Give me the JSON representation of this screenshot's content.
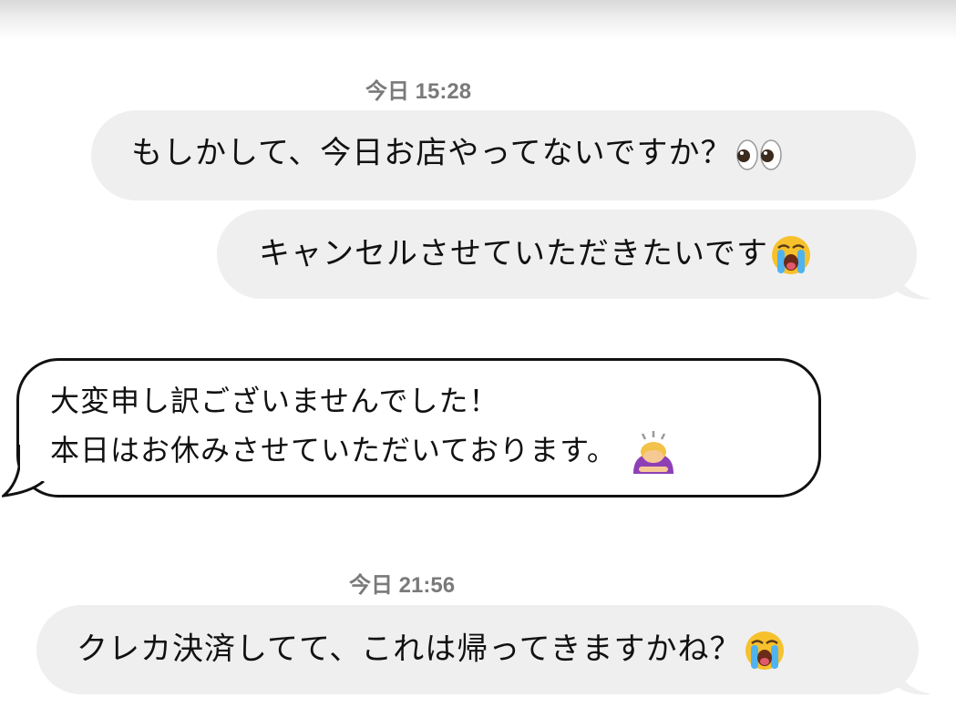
{
  "messages": [
    {
      "timestamp": "今日 15:28"
    },
    {
      "text": "もしかして、今日お店やってないですか？",
      "emoji": "eyes-emoji"
    },
    {
      "text": "キャンセルさせていただきたいです",
      "emoji": "loudly-crying-face-emoji"
    },
    {
      "line1": "大変申し訳ございませんでした！",
      "line2": "本日はお休みさせていただいております。",
      "emoji": "person-bowing-emoji"
    },
    {
      "timestamp": "今日 21:56"
    },
    {
      "text": "クレカ決済してて、これは帰ってきますかね？",
      "emoji": "loudly-crying-face-emoji"
    }
  ],
  "colors": {
    "bubble_bg": "#efefef",
    "timestamp": "#7a7a7a",
    "reply_border": "#111111"
  }
}
